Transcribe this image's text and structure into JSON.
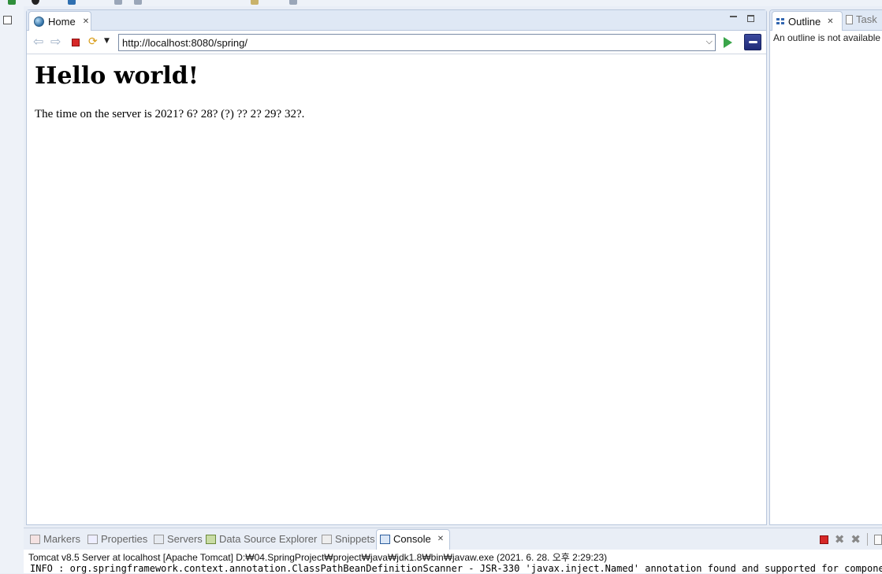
{
  "editor": {
    "tab_label": "Home",
    "url": "http://localhost:8080/spring/",
    "page": {
      "heading": "Hello world!",
      "time_text": "The time on the server is 2021? 6? 28? (?) ?? 2? 29? 32?."
    }
  },
  "outline": {
    "tab_label": "Outline",
    "task_label": "Task",
    "message": "An outline is not available"
  },
  "bottom_panel": {
    "tabs": [
      {
        "label": "Markers",
        "icon": "markers-icon"
      },
      {
        "label": "Properties",
        "icon": "properties-icon"
      },
      {
        "label": "Servers",
        "icon": "servers-icon"
      },
      {
        "label": "Data Source Explorer",
        "icon": "data-source-icon"
      },
      {
        "label": "Snippets",
        "icon": "snippets-icon"
      },
      {
        "label": "Console",
        "icon": "console-icon",
        "active": true
      }
    ],
    "console_header": "Tomcat v8.5 Server at localhost [Apache Tomcat] D:₩04.SpringProject₩project₩java₩jdk1.8₩bin₩javaw.exe (2021. 6. 28. 오후 2:29:23)",
    "console_line": "INFO : org.springframework.context.annotation.ClassPathBeanDefinitionScanner - JSR-330 'javax.inject.Named' annotation found and supported for component scan"
  },
  "colors": {
    "stop_red": "#d62828",
    "go_green": "#3aa54a",
    "chrome_bg": "#e9eef6"
  }
}
